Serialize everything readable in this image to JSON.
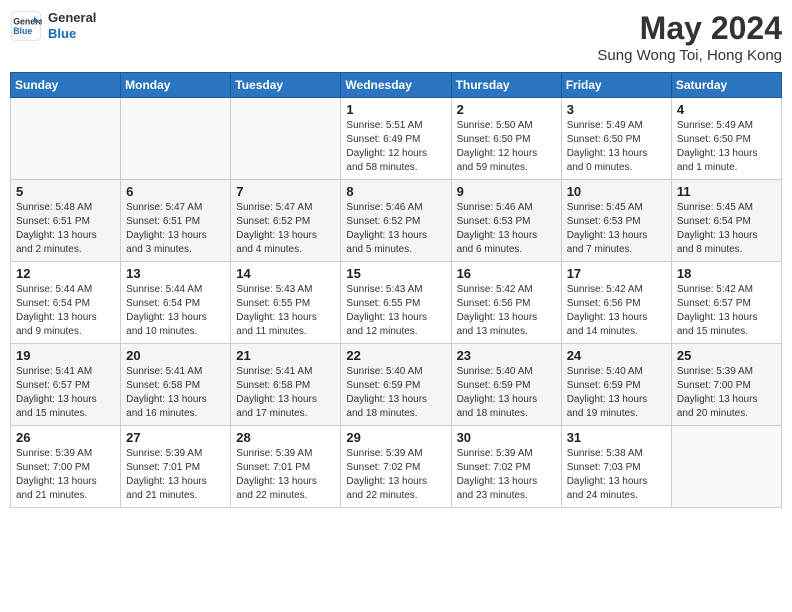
{
  "header": {
    "logo_line1": "General",
    "logo_line2": "Blue",
    "month_year": "May 2024",
    "location": "Sung Wong Toi, Hong Kong"
  },
  "weekdays": [
    "Sunday",
    "Monday",
    "Tuesday",
    "Wednesday",
    "Thursday",
    "Friday",
    "Saturday"
  ],
  "weeks": [
    {
      "days": [
        {
          "num": "",
          "text": ""
        },
        {
          "num": "",
          "text": ""
        },
        {
          "num": "",
          "text": ""
        },
        {
          "num": "1",
          "text": "Sunrise: 5:51 AM\nSunset: 6:49 PM\nDaylight: 12 hours and 58 minutes."
        },
        {
          "num": "2",
          "text": "Sunrise: 5:50 AM\nSunset: 6:50 PM\nDaylight: 12 hours and 59 minutes."
        },
        {
          "num": "3",
          "text": "Sunrise: 5:49 AM\nSunset: 6:50 PM\nDaylight: 13 hours and 0 minutes."
        },
        {
          "num": "4",
          "text": "Sunrise: 5:49 AM\nSunset: 6:50 PM\nDaylight: 13 hours and 1 minute."
        }
      ]
    },
    {
      "days": [
        {
          "num": "5",
          "text": "Sunrise: 5:48 AM\nSunset: 6:51 PM\nDaylight: 13 hours and 2 minutes."
        },
        {
          "num": "6",
          "text": "Sunrise: 5:47 AM\nSunset: 6:51 PM\nDaylight: 13 hours and 3 minutes."
        },
        {
          "num": "7",
          "text": "Sunrise: 5:47 AM\nSunset: 6:52 PM\nDaylight: 13 hours and 4 minutes."
        },
        {
          "num": "8",
          "text": "Sunrise: 5:46 AM\nSunset: 6:52 PM\nDaylight: 13 hours and 5 minutes."
        },
        {
          "num": "9",
          "text": "Sunrise: 5:46 AM\nSunset: 6:53 PM\nDaylight: 13 hours and 6 minutes."
        },
        {
          "num": "10",
          "text": "Sunrise: 5:45 AM\nSunset: 6:53 PM\nDaylight: 13 hours and 7 minutes."
        },
        {
          "num": "11",
          "text": "Sunrise: 5:45 AM\nSunset: 6:54 PM\nDaylight: 13 hours and 8 minutes."
        }
      ]
    },
    {
      "days": [
        {
          "num": "12",
          "text": "Sunrise: 5:44 AM\nSunset: 6:54 PM\nDaylight: 13 hours and 9 minutes."
        },
        {
          "num": "13",
          "text": "Sunrise: 5:44 AM\nSunset: 6:54 PM\nDaylight: 13 hours and 10 minutes."
        },
        {
          "num": "14",
          "text": "Sunrise: 5:43 AM\nSunset: 6:55 PM\nDaylight: 13 hours and 11 minutes."
        },
        {
          "num": "15",
          "text": "Sunrise: 5:43 AM\nSunset: 6:55 PM\nDaylight: 13 hours and 12 minutes."
        },
        {
          "num": "16",
          "text": "Sunrise: 5:42 AM\nSunset: 6:56 PM\nDaylight: 13 hours and 13 minutes."
        },
        {
          "num": "17",
          "text": "Sunrise: 5:42 AM\nSunset: 6:56 PM\nDaylight: 13 hours and 14 minutes."
        },
        {
          "num": "18",
          "text": "Sunrise: 5:42 AM\nSunset: 6:57 PM\nDaylight: 13 hours and 15 minutes."
        }
      ]
    },
    {
      "days": [
        {
          "num": "19",
          "text": "Sunrise: 5:41 AM\nSunset: 6:57 PM\nDaylight: 13 hours and 15 minutes."
        },
        {
          "num": "20",
          "text": "Sunrise: 5:41 AM\nSunset: 6:58 PM\nDaylight: 13 hours and 16 minutes."
        },
        {
          "num": "21",
          "text": "Sunrise: 5:41 AM\nSunset: 6:58 PM\nDaylight: 13 hours and 17 minutes."
        },
        {
          "num": "22",
          "text": "Sunrise: 5:40 AM\nSunset: 6:59 PM\nDaylight: 13 hours and 18 minutes."
        },
        {
          "num": "23",
          "text": "Sunrise: 5:40 AM\nSunset: 6:59 PM\nDaylight: 13 hours and 18 minutes."
        },
        {
          "num": "24",
          "text": "Sunrise: 5:40 AM\nSunset: 6:59 PM\nDaylight: 13 hours and 19 minutes."
        },
        {
          "num": "25",
          "text": "Sunrise: 5:39 AM\nSunset: 7:00 PM\nDaylight: 13 hours and 20 minutes."
        }
      ]
    },
    {
      "days": [
        {
          "num": "26",
          "text": "Sunrise: 5:39 AM\nSunset: 7:00 PM\nDaylight: 13 hours and 21 minutes."
        },
        {
          "num": "27",
          "text": "Sunrise: 5:39 AM\nSunset: 7:01 PM\nDaylight: 13 hours and 21 minutes."
        },
        {
          "num": "28",
          "text": "Sunrise: 5:39 AM\nSunset: 7:01 PM\nDaylight: 13 hours and 22 minutes."
        },
        {
          "num": "29",
          "text": "Sunrise: 5:39 AM\nSunset: 7:02 PM\nDaylight: 13 hours and 22 minutes."
        },
        {
          "num": "30",
          "text": "Sunrise: 5:39 AM\nSunset: 7:02 PM\nDaylight: 13 hours and 23 minutes."
        },
        {
          "num": "31",
          "text": "Sunrise: 5:38 AM\nSunset: 7:03 PM\nDaylight: 13 hours and 24 minutes."
        },
        {
          "num": "",
          "text": ""
        }
      ]
    }
  ]
}
